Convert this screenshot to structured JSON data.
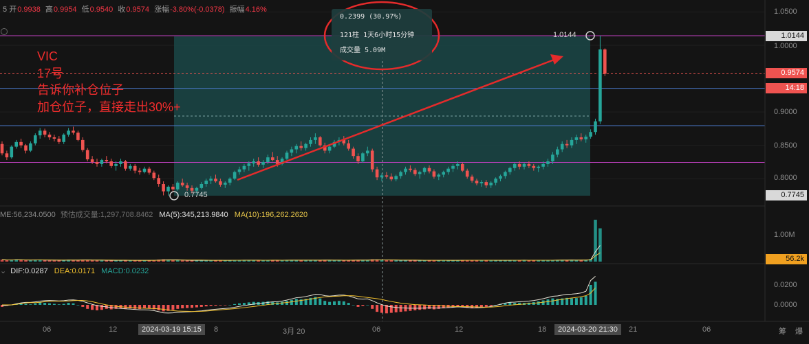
{
  "header": {
    "open_label": "开",
    "open": "0.9938",
    "high_label": "高",
    "high": "0.9954",
    "low_label": "低",
    "low": "0.9540",
    "close_label": "收",
    "close": "0.9574",
    "change_label": "涨幅",
    "change": "-3.80%(-0.0378)",
    "amplitude_label": "振幅",
    "amplitude": "4.16%"
  },
  "annotation": {
    "lines": [
      "VIC",
      "17号",
      "告诉你补仓位子",
      "加仓位子，直接走出30%+"
    ],
    "color": "#f02d2d"
  },
  "tooltip": {
    "line1": "0.2399 (30.97%)",
    "line2": "121柱 1天6小时15分钟",
    "line3": "成交量 5.09M"
  },
  "price_labels": {
    "high_marker": "1.0144",
    "low_marker": "0.7745"
  },
  "axis_tags": {
    "high": "1.0144",
    "last_price": "0.9574",
    "countdown": "14:18",
    "low": "0.7745",
    "volume_last": "56.2k"
  },
  "volume_status": {
    "volume_text": "ME:56,234.0500",
    "est_text": "预估成交量:1,297,708.8462",
    "ma5": "MA(5):345,213.9840",
    "ma10": "MA(10):196,262.2620"
  },
  "macd_status": {
    "dif": "DIF:0.0287",
    "dea": "DEA:0.0171",
    "macd": "MACD:0.0232"
  },
  "bottom_right": {
    "a": "筹",
    "b": "爆"
  },
  "colors": {
    "up": "#26a69a",
    "down": "#ef5350",
    "dif": "#e8e4d6",
    "dea": "#f2c12e",
    "ma10": "#e7c64a",
    "accent_red": "#f02d2d",
    "box": "#1e5a5a"
  },
  "chart_data": {
    "type": "candlestick",
    "price_axis": {
      "ticks": [
        0.8,
        0.85,
        0.9,
        1.0,
        1.05
      ],
      "tick_labels": [
        "0.8000",
        "0.8500",
        "0.9000",
        "1.0000",
        "1.0500"
      ]
    },
    "volume_axis": {
      "tick_labels": [
        "1.00M"
      ]
    },
    "macd_axis": {
      "tick_labels": [
        "0.0200",
        "0.0000"
      ]
    },
    "x_tick_labels": [
      "06",
      "12",
      "8",
      "3月 20",
      "06",
      "12",
      "18",
      "21",
      "06"
    ],
    "crosshair_x_tags": [
      "2024-03-19 15:15",
      "2024-03-20 21:30"
    ],
    "horizontal_lines": [
      1.0144,
      0.9574,
      0.9355,
      0.8795,
      0.8245
    ],
    "measure_range": {
      "from": 0.7745,
      "to": 1.0144,
      "change": 0.2399,
      "change_pct": 30.97,
      "bars": 121
    },
    "candles": [
      [
        0.852,
        0.856,
        0.835,
        0.838
      ],
      [
        0.838,
        0.842,
        0.828,
        0.832
      ],
      [
        0.832,
        0.85,
        0.83,
        0.848
      ],
      [
        0.848,
        0.858,
        0.845,
        0.855
      ],
      [
        0.855,
        0.86,
        0.846,
        0.85
      ],
      [
        0.85,
        0.852,
        0.838,
        0.842
      ],
      [
        0.842,
        0.856,
        0.84,
        0.853
      ],
      [
        0.853,
        0.868,
        0.85,
        0.865
      ],
      [
        0.865,
        0.876,
        0.86,
        0.872
      ],
      [
        0.872,
        0.875,
        0.862,
        0.866
      ],
      [
        0.866,
        0.87,
        0.858,
        0.862
      ],
      [
        0.862,
        0.866,
        0.856,
        0.86
      ],
      [
        0.86,
        0.864,
        0.852,
        0.855
      ],
      [
        0.855,
        0.868,
        0.852,
        0.866
      ],
      [
        0.866,
        0.876,
        0.863,
        0.872
      ],
      [
        0.872,
        0.878,
        0.866,
        0.869
      ],
      [
        0.869,
        0.872,
        0.856,
        0.858
      ],
      [
        0.858,
        0.862,
        0.84,
        0.843
      ],
      [
        0.843,
        0.846,
        0.826,
        0.829
      ],
      [
        0.829,
        0.834,
        0.822,
        0.825
      ],
      [
        0.825,
        0.83,
        0.818,
        0.822
      ],
      [
        0.822,
        0.83,
        0.818,
        0.828
      ],
      [
        0.828,
        0.834,
        0.823,
        0.826
      ],
      [
        0.826,
        0.83,
        0.816,
        0.819
      ],
      [
        0.819,
        0.826,
        0.812,
        0.822
      ],
      [
        0.822,
        0.83,
        0.818,
        0.826
      ],
      [
        0.826,
        0.828,
        0.812,
        0.815
      ],
      [
        0.815,
        0.822,
        0.812,
        0.819
      ],
      [
        0.819,
        0.822,
        0.808,
        0.812
      ],
      [
        0.812,
        0.816,
        0.806,
        0.81
      ],
      [
        0.81,
        0.818,
        0.808,
        0.815
      ],
      [
        0.815,
        0.818,
        0.806,
        0.809
      ],
      [
        0.809,
        0.812,
        0.798,
        0.801
      ],
      [
        0.801,
        0.806,
        0.788,
        0.792
      ],
      [
        0.792,
        0.796,
        0.775,
        0.781
      ],
      [
        0.781,
        0.79,
        0.7745,
        0.788
      ],
      [
        0.788,
        0.792,
        0.78,
        0.784
      ],
      [
        0.784,
        0.796,
        0.782,
        0.794
      ],
      [
        0.794,
        0.8,
        0.788,
        0.79
      ],
      [
        0.79,
        0.794,
        0.782,
        0.786
      ],
      [
        0.786,
        0.79,
        0.778,
        0.782
      ],
      [
        0.782,
        0.788,
        0.778,
        0.786
      ],
      [
        0.786,
        0.795,
        0.784,
        0.792
      ],
      [
        0.792,
        0.8,
        0.788,
        0.797
      ],
      [
        0.797,
        0.804,
        0.792,
        0.8
      ],
      [
        0.8,
        0.806,
        0.794,
        0.796
      ],
      [
        0.796,
        0.8,
        0.788,
        0.791
      ],
      [
        0.791,
        0.796,
        0.786,
        0.794
      ],
      [
        0.794,
        0.802,
        0.79,
        0.8
      ],
      [
        0.8,
        0.812,
        0.798,
        0.81
      ],
      [
        0.81,
        0.818,
        0.806,
        0.814
      ],
      [
        0.814,
        0.822,
        0.81,
        0.819
      ],
      [
        0.819,
        0.826,
        0.812,
        0.823
      ],
      [
        0.823,
        0.83,
        0.818,
        0.826
      ],
      [
        0.826,
        0.832,
        0.818,
        0.821
      ],
      [
        0.821,
        0.828,
        0.816,
        0.825
      ],
      [
        0.825,
        0.836,
        0.822,
        0.832
      ],
      [
        0.832,
        0.84,
        0.826,
        0.828
      ],
      [
        0.828,
        0.834,
        0.818,
        0.822
      ],
      [
        0.822,
        0.832,
        0.82,
        0.83
      ],
      [
        0.83,
        0.842,
        0.828,
        0.839
      ],
      [
        0.839,
        0.848,
        0.834,
        0.844
      ],
      [
        0.844,
        0.852,
        0.838,
        0.849
      ],
      [
        0.849,
        0.856,
        0.842,
        0.846
      ],
      [
        0.846,
        0.854,
        0.842,
        0.852
      ],
      [
        0.852,
        0.862,
        0.848,
        0.858
      ],
      [
        0.858,
        0.868,
        0.852,
        0.862
      ],
      [
        0.862,
        0.864,
        0.848,
        0.85
      ],
      [
        0.85,
        0.854,
        0.838,
        0.842
      ],
      [
        0.842,
        0.85,
        0.838,
        0.848
      ],
      [
        0.848,
        0.858,
        0.846,
        0.855
      ],
      [
        0.855,
        0.862,
        0.85,
        0.858
      ],
      [
        0.858,
        0.864,
        0.85,
        0.853
      ],
      [
        0.853,
        0.858,
        0.842,
        0.845
      ],
      [
        0.845,
        0.848,
        0.83,
        0.834
      ],
      [
        0.834,
        0.838,
        0.822,
        0.826
      ],
      [
        0.826,
        0.84,
        0.824,
        0.838
      ],
      [
        0.838,
        0.848,
        0.834,
        0.842
      ],
      [
        0.842,
        0.845,
        0.81,
        0.814
      ],
      [
        0.814,
        0.818,
        0.798,
        0.802
      ],
      [
        0.802,
        0.808,
        0.796,
        0.805
      ],
      [
        0.805,
        0.81,
        0.8,
        0.803
      ],
      [
        0.803,
        0.808,
        0.796,
        0.799
      ],
      [
        0.799,
        0.806,
        0.796,
        0.804
      ],
      [
        0.804,
        0.812,
        0.8,
        0.81
      ],
      [
        0.81,
        0.818,
        0.806,
        0.815
      ],
      [
        0.815,
        0.82,
        0.81,
        0.813
      ],
      [
        0.813,
        0.816,
        0.804,
        0.807
      ],
      [
        0.807,
        0.812,
        0.8,
        0.81
      ],
      [
        0.81,
        0.818,
        0.806,
        0.816
      ],
      [
        0.816,
        0.82,
        0.808,
        0.811
      ],
      [
        0.811,
        0.814,
        0.8,
        0.803
      ],
      [
        0.803,
        0.808,
        0.798,
        0.806
      ],
      [
        0.806,
        0.812,
        0.802,
        0.81
      ],
      [
        0.81,
        0.818,
        0.806,
        0.815
      ],
      [
        0.815,
        0.822,
        0.81,
        0.819
      ],
      [
        0.819,
        0.826,
        0.814,
        0.822
      ],
      [
        0.822,
        0.824,
        0.81,
        0.812
      ],
      [
        0.812,
        0.815,
        0.8,
        0.803
      ],
      [
        0.803,
        0.806,
        0.794,
        0.797
      ],
      [
        0.797,
        0.8,
        0.79,
        0.793
      ],
      [
        0.793,
        0.798,
        0.788,
        0.795
      ],
      [
        0.795,
        0.798,
        0.786,
        0.79
      ],
      [
        0.79,
        0.796,
        0.786,
        0.794
      ],
      [
        0.794,
        0.802,
        0.79,
        0.8
      ],
      [
        0.8,
        0.806,
        0.796,
        0.804
      ],
      [
        0.804,
        0.812,
        0.8,
        0.81
      ],
      [
        0.81,
        0.818,
        0.806,
        0.816
      ],
      [
        0.816,
        0.824,
        0.812,
        0.822
      ],
      [
        0.822,
        0.826,
        0.814,
        0.818
      ],
      [
        0.818,
        0.824,
        0.814,
        0.822
      ],
      [
        0.822,
        0.826,
        0.816,
        0.819
      ],
      [
        0.819,
        0.822,
        0.812,
        0.816
      ],
      [
        0.816,
        0.82,
        0.81,
        0.818
      ],
      [
        0.818,
        0.826,
        0.814,
        0.822
      ],
      [
        0.822,
        0.83,
        0.818,
        0.826
      ],
      [
        0.826,
        0.84,
        0.822,
        0.836
      ],
      [
        0.836,
        0.848,
        0.832,
        0.844
      ],
      [
        0.844,
        0.856,
        0.84,
        0.852
      ],
      [
        0.852,
        0.858,
        0.846,
        0.85
      ],
      [
        0.85,
        0.862,
        0.846,
        0.858
      ],
      [
        0.858,
        0.866,
        0.852,
        0.862
      ],
      [
        0.862,
        0.868,
        0.856,
        0.859
      ],
      [
        0.859,
        0.866,
        0.854,
        0.863
      ],
      [
        0.863,
        0.874,
        0.86,
        0.87
      ],
      [
        0.87,
        0.89,
        0.866,
        0.886
      ],
      [
        0.886,
        1.0144,
        0.882,
        0.9938
      ],
      [
        0.9938,
        0.9954,
        0.954,
        0.9574
      ]
    ],
    "volume": [
      60,
      45,
      40,
      70,
      55,
      40,
      35,
      60,
      65,
      40,
      38,
      35,
      42,
      55,
      60,
      38,
      45,
      62,
      58,
      40,
      35,
      38,
      36,
      44,
      38,
      36,
      45,
      35,
      42,
      40,
      34,
      38,
      50,
      62,
      70,
      55,
      40,
      44,
      38,
      36,
      40,
      34,
      42,
      40,
      44,
      38,
      40,
      36,
      42,
      48,
      46,
      44,
      42,
      40,
      44,
      38,
      46,
      42,
      44,
      40,
      48,
      46,
      44,
      40,
      42,
      46,
      44,
      50,
      48,
      40,
      42,
      44,
      40,
      46,
      52,
      48,
      44,
      42,
      70,
      66,
      44,
      40,
      42,
      38,
      44,
      40,
      38,
      42,
      36,
      40,
      44,
      42,
      38,
      40,
      36,
      42,
      40,
      44,
      42,
      46,
      40,
      38,
      42,
      36,
      40,
      38,
      44,
      42,
      40,
      46,
      44,
      40,
      42,
      38,
      40,
      44,
      48,
      50,
      46,
      52,
      48,
      44,
      46,
      50,
      80,
      1270,
      1010
    ],
    "macd": [
      -0.002,
      -0.001,
      0.0,
      0.001,
      0.0015,
      0.001,
      0.0005,
      0.0015,
      0.0025,
      0.002,
      0.0015,
      0.001,
      0.0005,
      0.001,
      0.002,
      0.0015,
      0.0,
      -0.002,
      -0.004,
      -0.005,
      -0.0055,
      -0.005,
      -0.004,
      -0.0045,
      -0.004,
      -0.0035,
      -0.004,
      -0.0035,
      -0.004,
      -0.0042,
      -0.0035,
      -0.0038,
      -0.0045,
      -0.0055,
      -0.0065,
      -0.006,
      -0.005,
      -0.004,
      -0.0035,
      -0.0032,
      -0.003,
      -0.0025,
      -0.002,
      -0.0015,
      -0.001,
      -0.0008,
      -0.0005,
      -0.0003,
      0.0,
      0.0008,
      0.0015,
      0.002,
      0.0025,
      0.003,
      0.0028,
      0.003,
      0.0035,
      0.0032,
      0.0025,
      0.003,
      0.004,
      0.005,
      0.006,
      0.0055,
      0.006,
      0.007,
      0.008,
      0.0065,
      0.004,
      0.003,
      0.0035,
      0.004,
      0.0035,
      0.002,
      0.0,
      -0.002,
      -0.001,
      0.0,
      -0.004,
      -0.007,
      -0.008,
      -0.0085,
      -0.008,
      -0.0075,
      -0.007,
      -0.0065,
      -0.006,
      -0.0055,
      -0.005,
      -0.0045,
      -0.004,
      -0.0045,
      -0.004,
      -0.0035,
      -0.003,
      -0.0025,
      -0.002,
      -0.0025,
      -0.003,
      -0.0035,
      -0.003,
      -0.0025,
      -0.002,
      -0.001,
      0.0,
      0.001,
      0.002,
      0.0025,
      0.002,
      0.0022,
      0.002,
      0.0022,
      0.0028,
      0.0035,
      0.0045,
      0.0055,
      0.0065,
      0.006,
      0.0065,
      0.007,
      0.0065,
      0.0068,
      0.0075,
      0.009,
      0.02,
      0.0232
    ],
    "dif": [
      -0.001,
      -0.0005,
      0.0,
      0.001,
      0.002,
      0.0025,
      0.0025,
      0.003,
      0.0038,
      0.0042,
      0.0044,
      0.0042,
      0.004,
      0.0042,
      0.0048,
      0.005,
      0.0045,
      0.0035,
      0.002,
      0.0005,
      -0.0008,
      -0.0015,
      -0.002,
      -0.0028,
      -0.0032,
      -0.0035,
      -0.004,
      -0.0042,
      -0.0046,
      -0.005,
      -0.005,
      -0.0052,
      -0.0058,
      -0.0068,
      -0.008,
      -0.0082,
      -0.008,
      -0.0075,
      -0.0072,
      -0.007,
      -0.0068,
      -0.0064,
      -0.006,
      -0.0054,
      -0.0048,
      -0.0044,
      -0.004,
      -0.0036,
      -0.0032,
      -0.0024,
      -0.0015,
      -0.0008,
      0.0,
      0.0008,
      0.0012,
      0.0018,
      0.0025,
      0.003,
      0.0032,
      0.0038,
      0.0048,
      0.006,
      0.0072,
      0.0076,
      0.0084,
      0.0094,
      0.0106,
      0.0104,
      0.0092,
      0.0088,
      0.0092,
      0.0098,
      0.0098,
      0.009,
      0.0076,
      0.006,
      0.0058,
      0.006,
      0.0042,
      0.002,
      0.0002,
      -0.0012,
      -0.002,
      -0.0026,
      -0.003,
      -0.0032,
      -0.0034,
      -0.0034,
      -0.0034,
      -0.0032,
      -0.003,
      -0.0032,
      -0.0032,
      -0.003,
      -0.0028,
      -0.0024,
      -0.002,
      -0.0022,
      -0.0026,
      -0.003,
      -0.003,
      -0.0028,
      -0.0024,
      -0.0016,
      -0.0006,
      0.0006,
      0.0018,
      0.0026,
      0.0028,
      0.0032,
      0.0034,
      0.0038,
      0.0044,
      0.0052,
      0.0062,
      0.0074,
      0.0086,
      0.009,
      0.0098,
      0.0106,
      0.0108,
      0.0112,
      0.012,
      0.0136,
      0.0245,
      0.0287
    ],
    "dea": [
      0.0,
      0.0,
      0.0,
      0.0005,
      0.0012,
      0.002,
      0.0022,
      0.0022,
      0.0026,
      0.0032,
      0.0036,
      0.0037,
      0.0037,
      0.0037,
      0.0038,
      0.0042,
      0.0045,
      0.0045,
      0.004,
      0.0032,
      0.0021,
      0.001,
      0.0,
      -0.0008,
      -0.0015,
      -0.0019,
      -0.0022,
      -0.0026,
      -0.0029,
      -0.0032,
      -0.0034,
      -0.0036,
      -0.0037,
      -0.004,
      -0.0045,
      -0.0052,
      -0.0058,
      -0.0062,
      -0.0064,
      -0.0065,
      -0.0066,
      -0.0066,
      -0.0065,
      -0.0062,
      -0.0058,
      -0.0054,
      -0.005,
      -0.0046,
      -0.0042,
      -0.0038,
      -0.0033,
      -0.0028,
      -0.0022,
      -0.0016,
      -0.001,
      -0.0004,
      0.0003,
      0.0009,
      0.0015,
      0.0019,
      0.0024,
      0.003,
      0.0037,
      0.0045,
      0.0051,
      0.0058,
      0.0066,
      0.0074,
      0.008,
      0.0083,
      0.0086,
      0.0088,
      0.0091,
      0.0092,
      0.0091,
      0.0086,
      0.008,
      0.0074,
      0.0068,
      0.0062,
      0.0054,
      0.0043,
      0.0034,
      0.0025,
      0.0017,
      0.0012,
      0.0007,
      0.0003,
      0.0001,
      -0.0001,
      -0.0004,
      -0.0006,
      -0.0008,
      -0.0012,
      -0.0014,
      -0.0016,
      -0.0016,
      -0.0017,
      -0.0018,
      -0.0019,
      -0.0021,
      -0.0022,
      -0.0023,
      -0.0022,
      -0.0019,
      -0.0015,
      -0.0009,
      -0.0003,
      0.0001,
      0.0005,
      0.0008,
      0.0012,
      0.0016,
      0.0021,
      0.0027,
      0.0033,
      0.004,
      0.0048,
      0.0055,
      0.0063,
      0.0069,
      0.0075,
      0.0082,
      0.0092,
      0.0118,
      0.0171
    ]
  }
}
